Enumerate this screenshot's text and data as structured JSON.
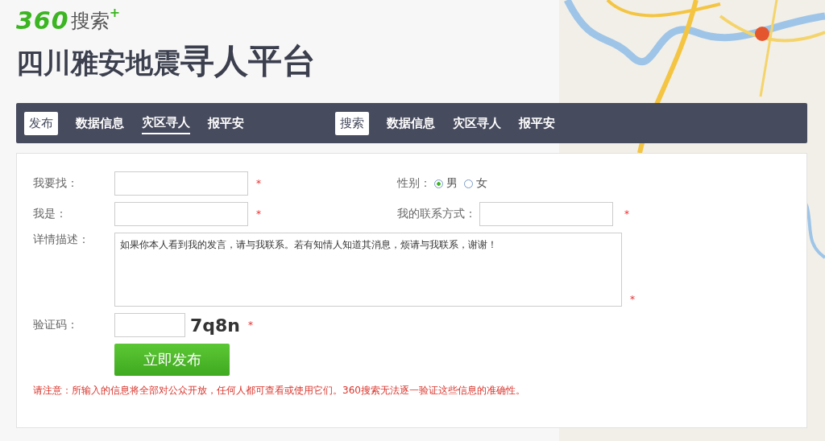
{
  "logo": {
    "brand": "360",
    "name": "搜索",
    "mark": "+"
  },
  "page_title": {
    "prefix": "四川雅安地震",
    "main": "寻人平台"
  },
  "nav": [
    {
      "heading": "发布",
      "links": [
        {
          "label": "数据信息",
          "selected": false
        },
        {
          "label": "灾区寻人",
          "selected": true
        },
        {
          "label": "报平安",
          "selected": false
        }
      ]
    },
    {
      "heading": "搜索",
      "links": [
        {
          "label": "数据信息",
          "selected": false
        },
        {
          "label": "灾区寻人",
          "selected": false
        },
        {
          "label": "报平安",
          "selected": false
        }
      ]
    }
  ],
  "form": {
    "seek": {
      "label": "我要找：",
      "required_mark": "*"
    },
    "gender": {
      "label": "性别：",
      "options": [
        {
          "label": "男",
          "selected": true
        },
        {
          "label": "女",
          "selected": false
        }
      ]
    },
    "me": {
      "label": "我是：",
      "required_mark": "*"
    },
    "contact": {
      "label": "我的联系方式：",
      "required_mark": "*"
    },
    "details": {
      "label": "详情描述：",
      "value": "如果你本人看到我的发言，请与我联系。若有知情人知道其消息，烦请与我联系，谢谢！",
      "required_mark": "*"
    },
    "captcha": {
      "label": "验证码：",
      "code": "7q8n",
      "required_mark": "*"
    },
    "submit": "立即发布",
    "notice": "请注意：所输入的信息将全部对公众开放，任何人都可查看或使用它们。360搜索无法逐一验证这些信息的准确性。"
  }
}
